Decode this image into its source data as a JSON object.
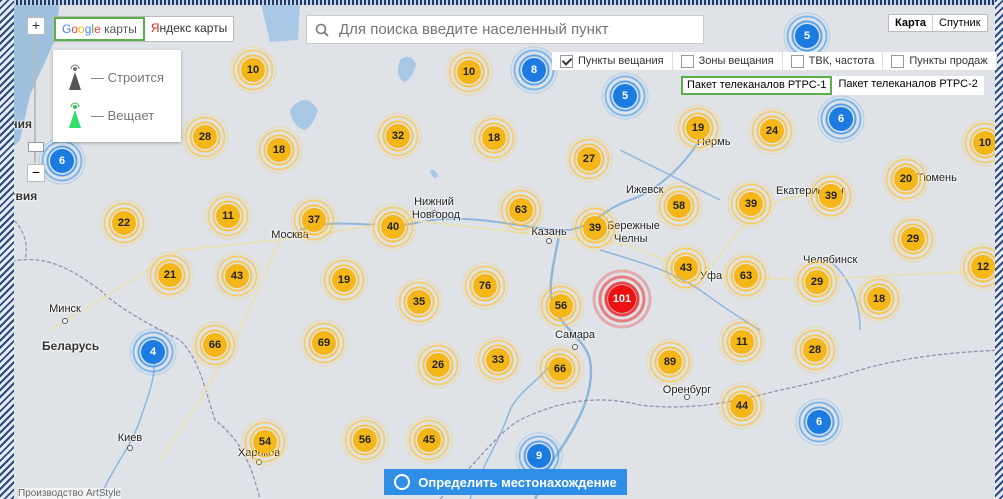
{
  "map_source": {
    "google_label_parts": [
      "G",
      "o",
      "o",
      "g",
      "l",
      "e"
    ],
    "google_suffix": " карты",
    "yandex_first": "Я",
    "yandex_rest": "ндекс карты"
  },
  "legend": {
    "building": "— Строится",
    "broadcasting": "— Вещает"
  },
  "search": {
    "placeholder": "Для поиска введите населенный пункт"
  },
  "map_type": {
    "map": "Карта",
    "satellite": "Спутник"
  },
  "filters": [
    {
      "label": "Пункты вещания",
      "checked": true
    },
    {
      "label": "Зоны вещания",
      "checked": false
    },
    {
      "label": "ТВК, частота",
      "checked": false
    },
    {
      "label": "Пункты продаж",
      "checked": false
    }
  ],
  "packages": [
    "Пакет телеканалов РТРС-1",
    "Пакет телеканалов РТРС-2"
  ],
  "locate_button": "Определить местонахождение",
  "footer": "Производство ArtStyle",
  "zoom": {
    "plus": "+",
    "minus": "−"
  },
  "cities": [
    {
      "name": "Москва",
      "big": false
    },
    {
      "name": "Нижний",
      "big": false
    },
    {
      "name": "Новгород",
      "big": false
    },
    {
      "name": "Казань",
      "big": false
    },
    {
      "name": "Бережные",
      "big": false
    },
    {
      "name": "Челны",
      "big": false
    },
    {
      "name": "Ижевск",
      "big": false
    },
    {
      "name": "Пермь",
      "big": false
    },
    {
      "name": "Екатеринбург",
      "big": false
    },
    {
      "name": "Тюмень",
      "big": false
    },
    {
      "name": "Челябинск",
      "big": false
    },
    {
      "name": "Уфа",
      "big": false
    },
    {
      "name": "Самара",
      "big": false
    },
    {
      "name": "Оренбург",
      "big": false
    },
    {
      "name": "Минск",
      "big": false
    },
    {
      "name": "Беларусь",
      "big": true
    },
    {
      "name": "Киев",
      "big": false
    },
    {
      "name": "Харьков",
      "big": false
    },
    {
      "name": "ония",
      "big": true
    },
    {
      "name": "атвия",
      "big": true
    }
  ],
  "clusters": [
    {
      "count": "10",
      "color": "orange"
    },
    {
      "count": "10",
      "color": "orange"
    },
    {
      "count": "8",
      "color": "blue"
    },
    {
      "count": "5",
      "color": "blue"
    },
    {
      "count": "5",
      "color": "blue"
    },
    {
      "count": "6",
      "color": "blue"
    },
    {
      "count": "6",
      "color": "blue"
    },
    {
      "count": "28",
      "color": "orange"
    },
    {
      "count": "18",
      "color": "orange"
    },
    {
      "count": "32",
      "color": "orange"
    },
    {
      "count": "18",
      "color": "orange"
    },
    {
      "count": "19",
      "color": "orange"
    },
    {
      "count": "24",
      "color": "orange"
    },
    {
      "count": "10",
      "color": "orange"
    },
    {
      "count": "27",
      "color": "orange"
    },
    {
      "count": "20",
      "color": "orange"
    },
    {
      "count": "22",
      "color": "orange"
    },
    {
      "count": "11",
      "color": "orange"
    },
    {
      "count": "37",
      "color": "orange"
    },
    {
      "count": "40",
      "color": "orange"
    },
    {
      "count": "63",
      "color": "orange"
    },
    {
      "count": "39",
      "color": "orange"
    },
    {
      "count": "58",
      "color": "orange"
    },
    {
      "count": "39",
      "color": "orange"
    },
    {
      "count": "39",
      "color": "orange"
    },
    {
      "count": "29",
      "color": "orange"
    },
    {
      "count": "12",
      "color": "orange"
    },
    {
      "count": "21",
      "color": "orange"
    },
    {
      "count": "43",
      "color": "orange"
    },
    {
      "count": "19",
      "color": "orange"
    },
    {
      "count": "76",
      "color": "orange"
    },
    {
      "count": "35",
      "color": "orange"
    },
    {
      "count": "56",
      "color": "orange"
    },
    {
      "count": "101",
      "color": "red"
    },
    {
      "count": "43",
      "color": "orange"
    },
    {
      "count": "63",
      "color": "orange"
    },
    {
      "count": "29",
      "color": "orange"
    },
    {
      "count": "18",
      "color": "orange"
    },
    {
      "count": "4",
      "color": "blue"
    },
    {
      "count": "66",
      "color": "orange"
    },
    {
      "count": "69",
      "color": "orange"
    },
    {
      "count": "26",
      "color": "orange"
    },
    {
      "count": "33",
      "color": "orange"
    },
    {
      "count": "66",
      "color": "orange"
    },
    {
      "count": "89",
      "color": "orange"
    },
    {
      "count": "11",
      "color": "orange"
    },
    {
      "count": "28",
      "color": "orange"
    },
    {
      "count": "44",
      "color": "orange"
    },
    {
      "count": "6",
      "color": "blue"
    },
    {
      "count": "54",
      "color": "orange"
    },
    {
      "count": "56",
      "color": "orange"
    },
    {
      "count": "45",
      "color": "orange"
    },
    {
      "count": "9",
      "color": "blue"
    }
  ]
}
